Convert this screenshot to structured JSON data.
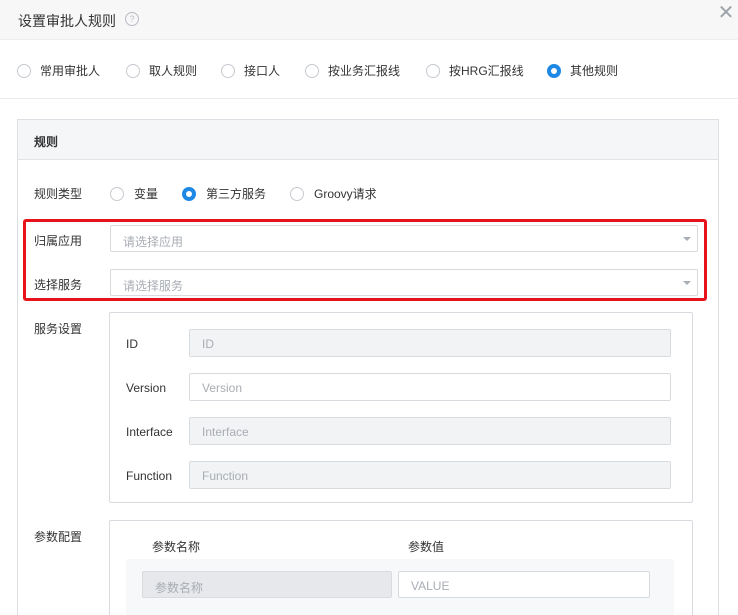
{
  "dialog": {
    "title": "设置审批人规则",
    "help_icon": "?",
    "close_icon": "✕"
  },
  "rule_tabs": [
    {
      "label": "常用审批人",
      "checked": false
    },
    {
      "label": "取人规则",
      "checked": false
    },
    {
      "label": "接口人",
      "checked": false
    },
    {
      "label": "按业务汇报线",
      "checked": false
    },
    {
      "label": "按HRG汇报线",
      "checked": false
    },
    {
      "label": "其他规则",
      "checked": true
    }
  ],
  "panel": {
    "title": "规则",
    "rule_type": {
      "label": "规则类型",
      "options": [
        {
          "label": "变量",
          "checked": false
        },
        {
          "label": "第三方服务",
          "checked": true
        },
        {
          "label": "Groovy请求",
          "checked": false
        }
      ]
    },
    "app": {
      "label": "归属应用",
      "placeholder": "请选择应用"
    },
    "service": {
      "label": "选择服务",
      "placeholder": "请选择服务"
    },
    "service_settings": {
      "label": "服务设置",
      "fields": [
        {
          "label": "ID",
          "placeholder": "ID",
          "disabled": true
        },
        {
          "label": "Version",
          "placeholder": "Version",
          "disabled": false
        },
        {
          "label": "Interface",
          "placeholder": "Interface",
          "disabled": true
        },
        {
          "label": "Function",
          "placeholder": "Function",
          "disabled": true
        }
      ]
    },
    "params": {
      "label": "参数配置",
      "name_header": "参数名称",
      "value_header": "参数值",
      "name_placeholder": "参数名称",
      "value_placeholder": "VALUE"
    }
  },
  "colors": {
    "accent": "#1e88e5",
    "highlight": "#e8121a"
  }
}
